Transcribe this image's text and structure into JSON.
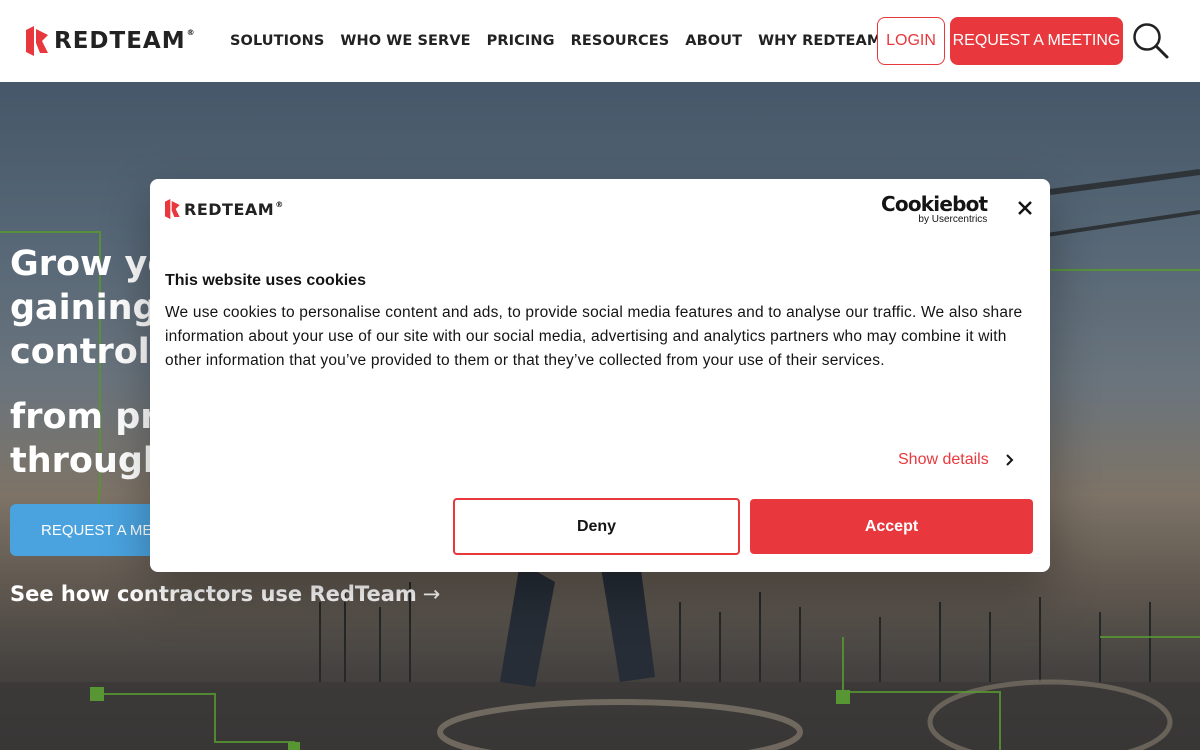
{
  "header": {
    "logo_text": "REDTEAM",
    "logo_registered": "®",
    "nav": [
      "SOLUTIONS",
      "WHO WE SERVE",
      "PRICING",
      "RESOURCES",
      "ABOUT",
      "WHY REDTEAM"
    ],
    "login_label": "LOGIN",
    "meeting_label": "REQUEST A MEETING",
    "search_icon": "search-icon"
  },
  "hero": {
    "heading_lines": [
      "Grow yo",
      "gaining t",
      "control,"
    ],
    "sub_lines": [
      "from pre",
      "through"
    ],
    "cta_label": "REQUEST A ME",
    "link_label": "See how contractors use RedTeam",
    "link_arrow": "→"
  },
  "cookie_dialog": {
    "logo_text": "REDTEAM",
    "logo_registered": "®",
    "provider_name": "Cookiebot",
    "provider_by": "by Usercentrics",
    "close_icon": "close-icon",
    "title": "This website uses cookies",
    "body": "We use cookies to personalise content and ads, to provide social media features and to analyse our traffic. We also share information about your use of our site with our social media, advertising and analytics partners who may combine it with other information that you’ve provided to them or that they’ve collected from your use of their services.",
    "show_details_label": "Show details",
    "deny_label": "Deny",
    "accept_label": "Accept"
  },
  "colors": {
    "brand_red": "#e8383d",
    "hero_cta_blue": "#4aa3df",
    "overlay_green": "#7dde3a"
  }
}
